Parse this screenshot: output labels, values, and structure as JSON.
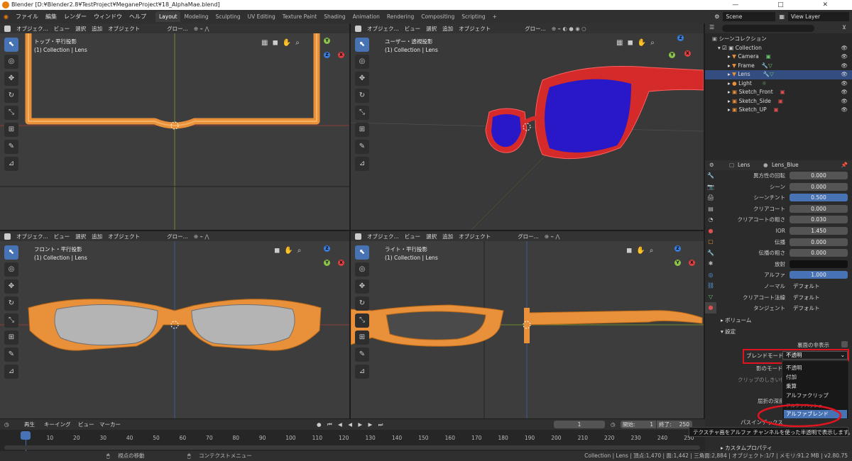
{
  "window": {
    "title": "Blender [D:¥Blender2.8¥TestProject¥MeganeProject¥18_AlphaMae.blend]",
    "controls": [
      "—",
      "□",
      "✕"
    ]
  },
  "menubar": {
    "items": [
      "ファイル",
      "編集",
      "レンダー",
      "ウィンドウ",
      "ヘルプ"
    ],
    "workspaces": [
      "Layout",
      "Modeling",
      "Sculpting",
      "UV Editing",
      "Texture Paint",
      "Shading",
      "Animation",
      "Rendering",
      "Compositing",
      "Scripting",
      "+"
    ],
    "active_workspace": "Layout",
    "scene": "Scene",
    "view_layer": "View Layer"
  },
  "viewport_header": {
    "mode": "オブジェク...",
    "menus": [
      "ビュー",
      "選択",
      "追加",
      "オブジェクト"
    ],
    "orientation": "グロー..."
  },
  "viewports": [
    {
      "name": "トップ・平行投影",
      "collection": "(1) Collection | Lens"
    },
    {
      "name": "ユーザー・透視投影",
      "collection": "(1) Collection | Lens"
    },
    {
      "name": "フロント・平行投影",
      "collection": "(1) Collection | Lens"
    },
    {
      "name": "ライト・平行投影",
      "collection": "(1) Collection | Lens"
    }
  ],
  "gizmo_axes": {
    "x": "X",
    "y": "Y",
    "z": "Z"
  },
  "outliner": {
    "root": "シーンコレクション",
    "collection": "Collection",
    "items": [
      {
        "name": "Camera",
        "selected": false
      },
      {
        "name": "Frame",
        "selected": false
      },
      {
        "name": "Lens",
        "selected": true
      },
      {
        "name": "Light",
        "selected": false
      },
      {
        "name": "Sketch_Front",
        "selected": false
      },
      {
        "name": "Sketch_Side",
        "selected": false
      },
      {
        "name": "Sketch_UP",
        "selected": false
      }
    ]
  },
  "properties": {
    "object": "Lens",
    "material": "Lens_Blue",
    "rows": [
      {
        "label": "異方性の回転",
        "value": "0.000",
        "style": "plain"
      },
      {
        "label": "シーン",
        "value": "0.000",
        "style": "plain"
      },
      {
        "label": "シーンチント",
        "value": "0.500",
        "style": "blue"
      },
      {
        "label": "クリアコート",
        "value": "0.000",
        "style": "plain"
      },
      {
        "label": "クリアコートの粗さ",
        "value": "0.030",
        "style": "plain"
      },
      {
        "label": "IOR",
        "value": "1.450",
        "style": "plain"
      },
      {
        "label": "伝播",
        "value": "0.000",
        "style": "plain"
      },
      {
        "label": "伝播の粗さ",
        "value": "0.000",
        "style": "plain"
      },
      {
        "label": "放射",
        "value": "",
        "style": "dark"
      },
      {
        "label": "アルファ",
        "value": "1.000",
        "style": "blue"
      },
      {
        "label": "ノーマル",
        "value": "デフォルト",
        "style": "drop"
      },
      {
        "label": "クリアコート法線",
        "value": "デフォルト",
        "style": "drop"
      },
      {
        "label": "タンジェント",
        "value": "デフォルト",
        "style": "drop"
      }
    ],
    "volume_panel": "ボリューム",
    "settings_panel": "設定",
    "backface_label": "裏面の非表示",
    "blend_mode_label": "ブレンドモード",
    "blend_mode_value": "不透明",
    "shadow_mode_label": "影のモード",
    "clip_threshold_label": "クリップのしきい値",
    "refraction_depth_label": "屈折の深度",
    "pass_index_label": "パスインデックス",
    "custom_props": "カスタムプロパティ",
    "highlight_color": "#e0141e"
  },
  "dropdown": {
    "options": [
      "不透明",
      "付加",
      "乗算",
      "アルファクリップ",
      "アルファハッシュ",
      "アルファブレンド"
    ],
    "highlighted": "アルファブレンド"
  },
  "tooltip": "テクスチャ画をアルファ チャンネルを使った半透明で表示します。",
  "timeline": {
    "menus": [
      "再生",
      "キーイング",
      "ビュー",
      "マーカー"
    ],
    "current_frame": "1",
    "start_label": "開始:",
    "start": "1",
    "end_label": "終了:",
    "end": "250",
    "ticks": [
      "1",
      "10",
      "20",
      "30",
      "40",
      "50",
      "60",
      "70",
      "80",
      "90",
      "100",
      "110",
      "120",
      "130",
      "140",
      "150",
      "160",
      "170",
      "180",
      "190",
      "200",
      "210",
      "220",
      "230",
      "240",
      "250"
    ]
  },
  "statusbar": {
    "left": "視点の移動",
    "middle": "コンテクストメニュー",
    "right": "Collection | Lens | 頂点:1,470 | 面:1,442 | 三角面:2,884 | オブジェクト:1/7 | メモリ:91.2 MB | v2.80.75"
  },
  "colors": {
    "frame": "#e8903a",
    "lens_red": "#e03030",
    "lens_blue": "#2818c8",
    "lens_gray": "#b4b4b4",
    "accent": "#4772b3"
  }
}
